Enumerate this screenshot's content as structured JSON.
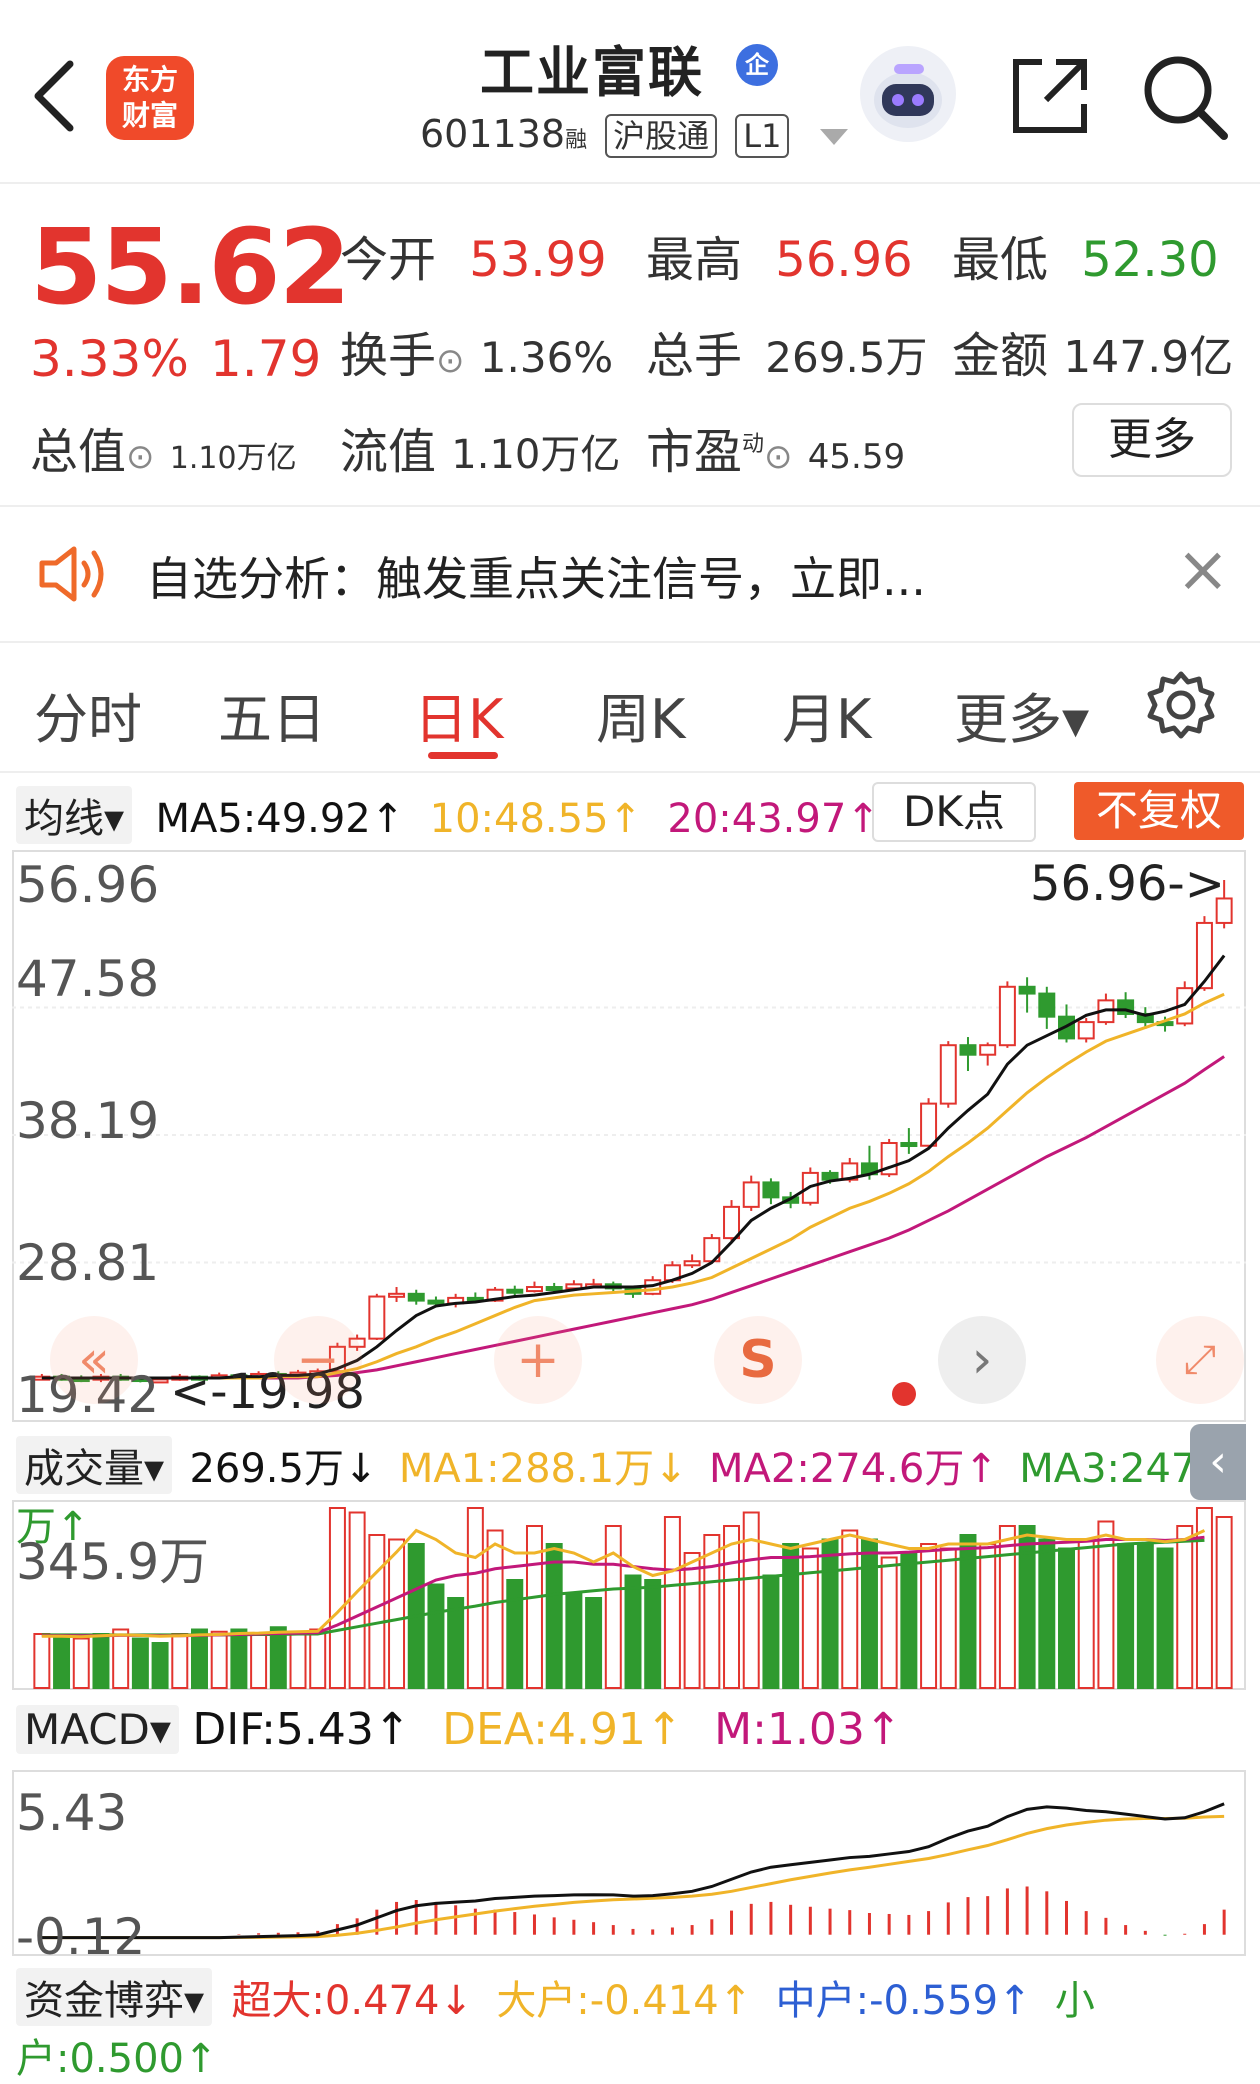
{
  "header": {
    "back_icon": "chevron-left-icon",
    "logo_line1": "东方",
    "logo_line2": "财富",
    "title": "工业富联",
    "enterprise_badge": "企",
    "code": "601138",
    "code_suffix": "融",
    "tag_connect": "沪股通",
    "tag_level": "L1",
    "share_icon": "share-icon",
    "search_icon": "search-icon"
  },
  "quote": {
    "price": "55.62",
    "change_pct": "3.33%",
    "change": "1.79",
    "open_label": "今开",
    "open": "53.99",
    "high_label": "最高",
    "high": "56.96",
    "low_label": "最低",
    "low": "52.30",
    "turnover_label": "换手",
    "turnover": "1.36%",
    "volume_label": "总手",
    "volume": "269.5万",
    "amount_label": "金额",
    "amount": "147.9亿",
    "mktcap_label": "总值",
    "mktcap": "1.10万亿",
    "float_label": "流值",
    "float": "1.10万亿",
    "pe_label": "市盈",
    "pe_sup": "动",
    "pe": "45.59",
    "more": "更多"
  },
  "notice": {
    "text": "自选分析：触发重点关注信号，立即...",
    "close": "×"
  },
  "tabs": [
    {
      "label": "分时"
    },
    {
      "label": "五日"
    },
    {
      "label": "日K"
    },
    {
      "label": "周K"
    },
    {
      "label": "月K"
    },
    {
      "label": "更多▾"
    }
  ],
  "kline_bar": {
    "select": "均线▾",
    "ma5": "MA5:49.92↑",
    "ma10": "10:48.55↑",
    "ma20": "20:43.97↑",
    "dk": "DK点",
    "adjust": "不复权"
  },
  "price_axis": [
    "56.96",
    "47.58",
    "38.19",
    "28.81",
    "19.42"
  ],
  "kline_labels": {
    "high_mark": "56.96->",
    "low_mark": "<-19.98"
  },
  "volume_bar": {
    "select": "成交量▾",
    "vol": "269.5万↓",
    "ma1": "MA1:288.1万↓",
    "ma2": "MA2:274.6万↑",
    "ma3": "MA3:247.8万↑",
    "axis": "345.9万"
  },
  "macd_bar": {
    "select": "MACD▾",
    "dif": "DIF:5.43↑",
    "dea": "DEA:4.91↑",
    "m": "M:1.03↑",
    "axis_top": "5.43",
    "axis_bottom": "-0.12"
  },
  "fund_bar": {
    "select": "资金博弈▾",
    "super": "超大:0.474↓",
    "large": "大户:-0.414↑",
    "mid": "中户:-0.559↑",
    "small": "小户:0.500↑"
  },
  "colors": {
    "up": "#e2342e",
    "down": "#2f9a2f",
    "ma5": "#111111",
    "ma10": "#f0b429",
    "ma20": "#c2187a",
    "mid": "#2d5fd3"
  },
  "chart_data": {
    "type": "candlestick",
    "ylim": [
      19.42,
      56.96
    ],
    "candles": [
      [
        20.3,
        20.4,
        20.6,
        20.2
      ],
      [
        20.4,
        20.3,
        20.6,
        20.1
      ],
      [
        20.3,
        20.2,
        20.5,
        20.0
      ],
      [
        20.2,
        20.4,
        20.6,
        20.0
      ],
      [
        20.4,
        20.3,
        20.6,
        20.1
      ],
      [
        20.3,
        20.1,
        20.4,
        19.98
      ],
      [
        20.1,
        20.2,
        20.4,
        20.0
      ],
      [
        20.2,
        20.4,
        20.6,
        20.1
      ],
      [
        20.4,
        20.3,
        20.5,
        20.1
      ],
      [
        20.3,
        20.5,
        20.7,
        20.2
      ],
      [
        20.5,
        20.4,
        20.6,
        20.2
      ],
      [
        20.4,
        20.6,
        20.8,
        20.3
      ],
      [
        20.6,
        20.5,
        20.8,
        20.3
      ],
      [
        20.5,
        20.7,
        20.9,
        20.4
      ],
      [
        20.7,
        20.8,
        21.0,
        20.5
      ],
      [
        20.8,
        22.6,
        22.9,
        20.7
      ],
      [
        22.6,
        23.2,
        23.5,
        22.3
      ],
      [
        23.2,
        26.3,
        26.5,
        23.1
      ],
      [
        26.3,
        26.5,
        27.0,
        25.9
      ],
      [
        26.5,
        26.0,
        26.8,
        25.7
      ],
      [
        26.0,
        25.8,
        26.3,
        25.5
      ],
      [
        25.8,
        26.2,
        26.5,
        25.5
      ],
      [
        26.2,
        26.0,
        26.6,
        25.8
      ],
      [
        26.0,
        26.8,
        27.0,
        25.9
      ],
      [
        26.8,
        26.7,
        27.1,
        26.4
      ],
      [
        26.7,
        27.0,
        27.4,
        26.6
      ],
      [
        27.0,
        26.9,
        27.3,
        26.6
      ],
      [
        26.9,
        27.2,
        27.5,
        26.8
      ],
      [
        27.2,
        27.2,
        27.6,
        26.9
      ],
      [
        27.2,
        26.9,
        27.4,
        26.6
      ],
      [
        26.9,
        26.5,
        27.0,
        26.2
      ],
      [
        26.5,
        27.5,
        27.8,
        26.4
      ],
      [
        27.5,
        28.6,
        28.9,
        27.3
      ],
      [
        28.6,
        28.9,
        29.4,
        28.4
      ],
      [
        28.9,
        30.6,
        30.9,
        28.8
      ],
      [
        30.6,
        32.9,
        33.4,
        30.4
      ],
      [
        32.9,
        34.7,
        35.2,
        32.6
      ],
      [
        34.7,
        33.6,
        35.0,
        33.1
      ],
      [
        33.6,
        33.2,
        34.0,
        32.8
      ],
      [
        33.2,
        35.4,
        35.8,
        33.0
      ],
      [
        35.4,
        34.9,
        35.6,
        34.6
      ],
      [
        34.9,
        36.1,
        36.5,
        34.7
      ],
      [
        36.1,
        35.3,
        37.4,
        34.9
      ],
      [
        35.3,
        37.6,
        37.9,
        35.1
      ],
      [
        37.6,
        37.4,
        38.7,
        36.8
      ],
      [
        37.4,
        40.5,
        40.9,
        37.2
      ],
      [
        40.5,
        44.8,
        45.1,
        40.2
      ],
      [
        44.8,
        44.1,
        45.4,
        42.9
      ],
      [
        44.1,
        44.8,
        45.0,
        43.3
      ],
      [
        44.8,
        49.1,
        49.5,
        44.6
      ],
      [
        49.1,
        48.6,
        49.8,
        47.2
      ],
      [
        48.6,
        46.9,
        49.1,
        46.0
      ],
      [
        46.9,
        45.3,
        47.8,
        45.0
      ],
      [
        45.3,
        46.5,
        46.8,
        45.0
      ],
      [
        46.5,
        48.1,
        48.6,
        46.3
      ],
      [
        48.1,
        47.1,
        48.7,
        46.8
      ],
      [
        47.1,
        46.5,
        47.6,
        46.0
      ],
      [
        46.5,
        46.4,
        46.9,
        45.8
      ],
      [
        46.4,
        49.0,
        49.5,
        46.2
      ],
      [
        49.0,
        53.8,
        54.3,
        48.8
      ],
      [
        53.8,
        55.6,
        56.96,
        53.4
      ]
    ],
    "ma5": [
      20.3,
      20.3,
      20.3,
      20.3,
      20.3,
      20.3,
      20.3,
      20.3,
      20.3,
      20.3,
      20.4,
      20.4,
      20.5,
      20.5,
      20.6,
      21.0,
      21.6,
      22.6,
      23.8,
      24.9,
      25.6,
      25.8,
      25.9,
      26.1,
      26.3,
      26.4,
      26.6,
      26.8,
      27.0,
      27.0,
      27.0,
      27.1,
      27.5,
      28.0,
      28.8,
      30.3,
      31.9,
      32.8,
      33.5,
      34.4,
      34.8,
      35.0,
      35.3,
      35.8,
      36.3,
      37.2,
      38.7,
      40.0,
      41.2,
      43.4,
      44.8,
      45.5,
      46.2,
      47.0,
      47.4,
      47.4,
      47.0,
      47.3,
      47.8,
      49.5,
      51.4
    ],
    "ma10": [
      20.3,
      20.3,
      20.3,
      20.3,
      20.3,
      20.3,
      20.3,
      20.3,
      20.3,
      20.3,
      20.3,
      20.3,
      20.4,
      20.4,
      20.4,
      20.7,
      21.0,
      21.5,
      22.1,
      22.6,
      23.2,
      23.7,
      24.3,
      24.9,
      25.5,
      26.0,
      26.2,
      26.4,
      26.5,
      26.6,
      26.7,
      26.8,
      27.0,
      27.3,
      27.7,
      28.4,
      29.1,
      29.8,
      30.5,
      31.4,
      32.1,
      32.8,
      33.3,
      33.9,
      34.6,
      35.5,
      36.6,
      37.6,
      38.7,
      40.0,
      41.3,
      42.4,
      43.4,
      44.3,
      45.1,
      45.6,
      46.1,
      46.6,
      47.1,
      47.9,
      48.55
    ],
    "ma20": [
      20.3,
      20.3,
      20.3,
      20.3,
      20.3,
      20.3,
      20.3,
      20.3,
      20.3,
      20.3,
      20.3,
      20.3,
      20.3,
      20.3,
      20.4,
      20.5,
      20.7,
      20.9,
      21.2,
      21.5,
      21.8,
      22.1,
      22.4,
      22.7,
      23.0,
      23.3,
      23.6,
      23.9,
      24.2,
      24.5,
      24.8,
      25.1,
      25.4,
      25.7,
      26.1,
      26.6,
      27.1,
      27.6,
      28.1,
      28.6,
      29.1,
      29.6,
      30.1,
      30.6,
      31.2,
      31.9,
      32.6,
      33.4,
      34.2,
      35.0,
      35.8,
      36.6,
      37.3,
      38.0,
      38.8,
      39.6,
      40.4,
      41.2,
      42.0,
      43.0,
      43.97
    ],
    "volume": {
      "ylim": [
        0,
        400
      ],
      "values": [
        120,
        115,
        110,
        120,
        130,
        110,
        100,
        120,
        130,
        125,
        130,
        120,
        135,
        125,
        130,
        400,
        390,
        340,
        330,
        320,
        230,
        200,
        400,
        350,
        240,
        360,
        320,
        210,
        200,
        360,
        250,
        240,
        380,
        300,
        340,
        360,
        390,
        250,
        320,
        310,
        330,
        350,
        330,
        290,
        300,
        320,
        310,
        340,
        320,
        360,
        360,
        330,
        310,
        330,
        370,
        320,
        320,
        310,
        360,
        400,
        380
      ],
      "up": [
        1,
        0,
        1,
        0,
        1,
        0,
        0,
        1,
        0,
        1,
        0,
        1,
        0,
        1,
        1,
        1,
        1,
        1,
        1,
        0,
        0,
        0,
        1,
        1,
        0,
        1,
        0,
        0,
        0,
        1,
        0,
        0,
        1,
        1,
        1,
        1,
        1,
        0,
        0,
        1,
        0,
        1,
        0,
        1,
        0,
        1,
        1,
        0,
        1,
        1,
        0,
        0,
        0,
        1,
        1,
        0,
        0,
        0,
        1,
        1,
        1
      ],
      "ma1": [
        115,
        115,
        114,
        116,
        118,
        117,
        115,
        116,
        118,
        119,
        121,
        122,
        124,
        125,
        126,
        168,
        214,
        258,
        302,
        350,
        330,
        300,
        290,
        320,
        300,
        300,
        310,
        300,
        280,
        300,
        270,
        250,
        260,
        280,
        300,
        320,
        330,
        320,
        310,
        320,
        330,
        340,
        330,
        320,
        310,
        310,
        320,
        320,
        320,
        330,
        340,
        335,
        330,
        330,
        340,
        330,
        330,
        325,
        330,
        350,
        288
      ],
      "ma2": [
        116,
        116,
        116,
        116,
        117,
        117,
        116,
        116,
        117,
        118,
        119,
        120,
        121,
        122,
        123,
        140,
        160,
        180,
        200,
        220,
        240,
        250,
        255,
        265,
        270,
        275,
        280,
        280,
        275,
        275,
        270,
        265,
        262,
        265,
        270,
        278,
        285,
        290,
        290,
        292,
        295,
        298,
        300,
        300,
        302,
        305,
        308,
        310,
        312,
        316,
        320,
        322,
        324,
        326,
        330,
        330,
        330,
        328,
        330,
        335,
        274.6
      ],
      "ma3": [
        118,
        118,
        118,
        118,
        118,
        118,
        118,
        118,
        118,
        118,
        118,
        119,
        119,
        120,
        120,
        128,
        136,
        144,
        152,
        160,
        168,
        175,
        182,
        190,
        196,
        202,
        208,
        212,
        216,
        220,
        222,
        224,
        228,
        232,
        236,
        240,
        244,
        248,
        252,
        256,
        260,
        264,
        268,
        272,
        276,
        280,
        284,
        288,
        292,
        296,
        300,
        304,
        308,
        312,
        316,
        320,
        322,
        324,
        326,
        328,
        247.8
      ]
    },
    "macd": {
      "ylim": [
        -0.8,
        6.5
      ],
      "dif": [
        -0.12,
        -0.12,
        -0.12,
        -0.12,
        -0.12,
        -0.12,
        -0.12,
        -0.12,
        -0.12,
        -0.12,
        -0.1,
        -0.08,
        -0.06,
        -0.04,
        0.0,
        0.2,
        0.4,
        0.7,
        1.0,
        1.2,
        1.3,
        1.35,
        1.4,
        1.5,
        1.55,
        1.6,
        1.62,
        1.65,
        1.66,
        1.65,
        1.6,
        1.62,
        1.7,
        1.8,
        2.0,
        2.3,
        2.6,
        2.8,
        2.9,
        3.0,
        3.1,
        3.2,
        3.25,
        3.35,
        3.45,
        3.65,
        4.0,
        4.3,
        4.5,
        4.9,
        5.2,
        5.3,
        5.25,
        5.15,
        5.1,
        5.0,
        4.9,
        4.8,
        4.85,
        5.1,
        5.43
      ],
      "dea": [
        -0.12,
        -0.12,
        -0.12,
        -0.12,
        -0.12,
        -0.12,
        -0.12,
        -0.12,
        -0.12,
        -0.12,
        -0.11,
        -0.11,
        -0.1,
        -0.09,
        -0.08,
        -0.02,
        0.06,
        0.18,
        0.32,
        0.48,
        0.62,
        0.74,
        0.86,
        0.98,
        1.08,
        1.18,
        1.26,
        1.34,
        1.4,
        1.45,
        1.48,
        1.51,
        1.55,
        1.6,
        1.68,
        1.8,
        1.96,
        2.12,
        2.28,
        2.42,
        2.56,
        2.69,
        2.8,
        2.92,
        3.04,
        3.16,
        3.33,
        3.52,
        3.7,
        3.94,
        4.2,
        4.4,
        4.55,
        4.66,
        4.75,
        4.8,
        4.82,
        4.82,
        4.83,
        4.88,
        4.91
      ]
    }
  }
}
